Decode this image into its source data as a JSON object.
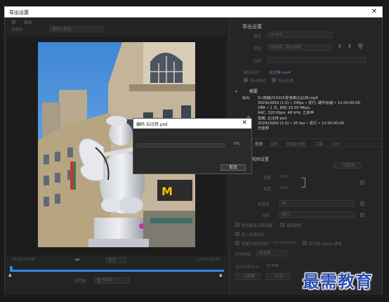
{
  "window": {
    "title": "导出设置",
    "close_icon": "close-icon"
  },
  "left": {
    "tabs": [
      "源",
      "输出"
    ],
    "source_scaling_label": "源缩放",
    "source_scaling_value": "缩放以适合",
    "timecode_start": "00;00;00;00",
    "timecode_end": "12;00;00;00",
    "fit_value": "适合",
    "source_range_label": "源范围",
    "source_range_value": "整个序列"
  },
  "export_settings": {
    "header": "导出设置",
    "format_label": "格式",
    "format_value": "H.264",
    "preset_label": "预设",
    "preset_value": "匹配源 - 高比特率",
    "comments_label": "注释",
    "output_name_label": "输出名称",
    "output_name_value": "丘比特.mp4",
    "export_video_label": "导出视频",
    "export_audio_label": "导出音频"
  },
  "summary": {
    "header": "摘要",
    "output_label": "输出",
    "output_lines": [
      "G:\\电脑\\f19315零佳锋\\丘比特.mp4",
      "3024x3950 (1.0) • 29fps • 逐行, 硬件加速 • 12:00:00:00",
      "VBR • 1 次, 目标 10.00 Mbps",
      "AAC, 320 Kbps, 48 kHz, 立体声"
    ],
    "source_label": "源",
    "source_lines": [
      "剪辑, 丘比特.psd",
      "3024x3950 (1.0) • 25 fps • 逐行 • 12:00:00:00",
      "无音频"
    ]
  },
  "tabs_right": [
    "效果",
    "视频",
    "音频",
    "多路复用器",
    "字幕",
    "发布"
  ],
  "video_settings": {
    "header": "基本视频设置",
    "match_source_button": "匹配源",
    "width_label": "宽度",
    "width_value": "3024",
    "height_label": "高度",
    "height_value": "3950",
    "frame_rate_label": "帧速率",
    "frame_rate_value": "29",
    "field_order_label": "场序",
    "field_order_value": "逐行"
  },
  "bottom_options": {
    "max_render_label": "使用最高渲染质量",
    "use_preview_label": "使用预览",
    "import_project_label": "导入到项目中",
    "set_start_tc_label": "设置开始时间码",
    "start_tc_value": "00;00;00;00",
    "render_alpha_label": "仅渲染 Alpha 通道",
    "time_interp_label": "时间插值",
    "time_interp_value": "帧采样",
    "file_size_label": "估计文件大小:",
    "file_size_value": "15 MB",
    "metadata_button": "元数据",
    "queue_button": "队列"
  },
  "progress_dialog": {
    "title": "编码 丘比特.psd",
    "percent": "0%",
    "progress_fraction": 0.0,
    "cancel_label": "取消"
  },
  "watermark": "最需教育",
  "colors": {
    "accent_blue": "#2d8ceb",
    "watermark": "#2f4fb0"
  }
}
